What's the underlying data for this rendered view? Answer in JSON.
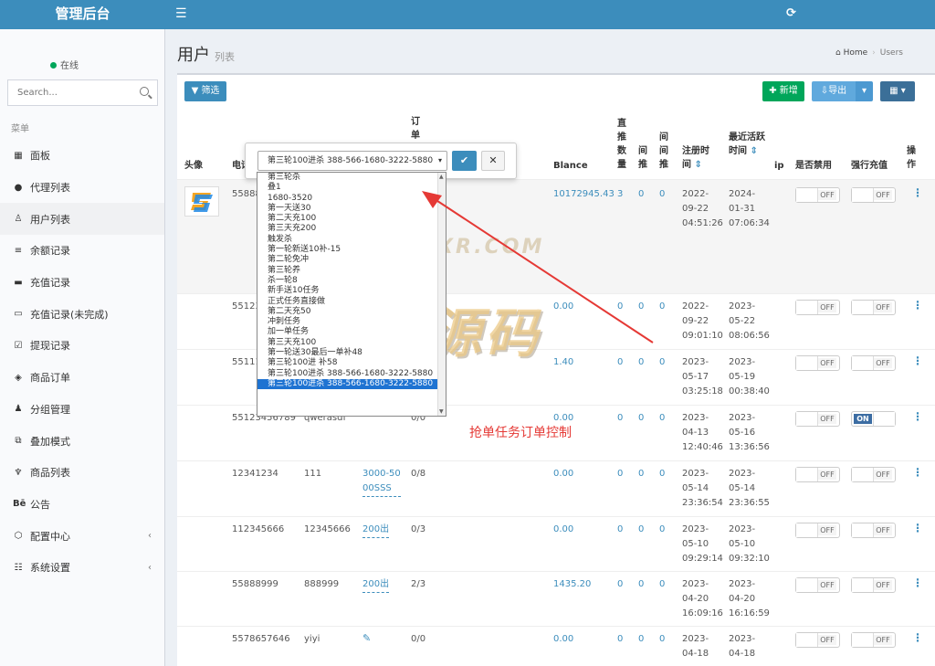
{
  "header": {
    "title": "管理后台"
  },
  "sidebar": {
    "status": "在线",
    "search_placeholder": "Search...",
    "menu_header": "菜单",
    "items": [
      {
        "label": "面板"
      },
      {
        "label": "代理列表"
      },
      {
        "label": "用户列表"
      },
      {
        "label": "余额记录"
      },
      {
        "label": "充值记录"
      },
      {
        "label": "充值记录(未完成)"
      },
      {
        "label": "提现记录"
      },
      {
        "label": "商品订单"
      },
      {
        "label": "分组管理"
      },
      {
        "label": "叠加模式"
      },
      {
        "label": "商品列表"
      },
      {
        "label": "公告"
      },
      {
        "label": "配置中心"
      },
      {
        "label": "系统设置"
      }
    ]
  },
  "page": {
    "title": "用户",
    "subtitle": "列表",
    "breadcrumb_home": "Home",
    "breadcrumb_current": "Users"
  },
  "toolbar": {
    "filter_label": "筛选",
    "add_label": "新增",
    "export_label": "导出"
  },
  "table": {
    "headers": {
      "avatar": "头像",
      "phone": "电话",
      "order": "订单",
      "balance": "Blance",
      "direct": "直推数量",
      "indirect": "间推",
      "indirect2": "间间推",
      "register": "注册时间",
      "last_active": "最近活跃时间",
      "ip": "ip",
      "disabled": "是否禁用",
      "force_recharge": "强行充值",
      "actions": "操作"
    },
    "rows": [
      {
        "phone": "55888",
        "account": "",
        "group": "",
        "orders": "",
        "balance": "10172945.43",
        "direct": "3",
        "indirect": "0",
        "indirect2": "0",
        "reg": [
          "2022-",
          "09-22",
          "04:51:26"
        ],
        "active": [
          "2024-",
          "01-31",
          "07:06:34"
        ],
        "disabled": "OFF",
        "force": "OFF"
      },
      {
        "phone": "55123",
        "account": "",
        "group": "",
        "orders": "",
        "balance": "0.00",
        "direct": "0",
        "indirect": "0",
        "indirect2": "0",
        "reg": [
          "2022-",
          "09-22",
          "09:01:10"
        ],
        "active": [
          "2023-",
          "05-22",
          "08:06:56"
        ],
        "disabled": "OFF",
        "force": "OFF"
      },
      {
        "phone": "55111",
        "account": "",
        "group": "",
        "orders": "",
        "balance": "1.40",
        "direct": "0",
        "indirect": "0",
        "indirect2": "0",
        "reg": [
          "2023-",
          "05-17",
          "03:25:18"
        ],
        "active": [
          "2023-",
          "05-19",
          "00:38:40"
        ],
        "disabled": "OFF",
        "force": "OFF"
      },
      {
        "phone": "55123456789",
        "account": "qwerasdf",
        "group": "",
        "orders": "0/0",
        "balance": "0.00",
        "direct": "0",
        "indirect": "0",
        "indirect2": "0",
        "reg": [
          "2023-",
          "04-13",
          "12:40:46"
        ],
        "active": [
          "2023-",
          "05-16",
          "13:36:56"
        ],
        "disabled": "OFF",
        "force": "ON"
      },
      {
        "phone": "12341234",
        "account": "111",
        "group": "3000-5000SSS",
        "orders": "0/8",
        "balance": "0.00",
        "direct": "0",
        "indirect": "0",
        "indirect2": "0",
        "reg": [
          "2023-",
          "05-14",
          "23:36:54"
        ],
        "active": [
          "2023-",
          "05-14",
          "23:36:55"
        ],
        "disabled": "OFF",
        "force": "OFF"
      },
      {
        "phone": "112345666",
        "account": "12345666",
        "group": "200出",
        "orders": "0/3",
        "balance": "0.00",
        "direct": "0",
        "indirect": "0",
        "indirect2": "0",
        "reg": [
          "2023-",
          "05-10",
          "09:29:14"
        ],
        "active": [
          "2023-",
          "05-10",
          "09:32:10"
        ],
        "disabled": "OFF",
        "force": "OFF"
      },
      {
        "phone": "55888999",
        "account": "888999",
        "group": "200出",
        "orders": "2/3",
        "balance": "1435.20",
        "direct": "0",
        "indirect": "0",
        "indirect2": "0",
        "reg": [
          "2023-",
          "04-20",
          "16:09:16"
        ],
        "active": [
          "2023-",
          "04-20",
          "16:16:59"
        ],
        "disabled": "OFF",
        "force": "OFF"
      },
      {
        "phone": "5578657646",
        "account": "yiyi",
        "group": "",
        "orders": "0/0",
        "balance": "0.00",
        "direct": "0",
        "indirect": "0",
        "indirect2": "0",
        "reg": [
          "2023-",
          "04-18",
          ""
        ],
        "active": [
          "2023-",
          "04-18",
          ""
        ],
        "disabled": "OFF",
        "force": "OFF"
      }
    ]
  },
  "popover": {
    "selected": "第三轮100进杀 388-566-1680-3222-5880",
    "options": [
      "第三轮杀",
      "叠1",
      "1680-3520",
      "第一天送30",
      "第二天充100",
      "第三天充200",
      "触发杀",
      "第一轮新送10补-15",
      "第二轮免冲",
      "第三轮养",
      "杀一轮8",
      "新手送10任务",
      "正式任务直接做",
      "第二天充50",
      "冲刺任务",
      "加一单任务",
      "第三天充100",
      "第一轮送30最后一单补48",
      "第三轮100进 补58",
      "第三轮100进杀 388-566-1680-3222-5880"
    ]
  },
  "annotation": "抢单任务订单控制",
  "watermark": {
    "small": "KYXR.COM",
    "big": "南亚源码"
  },
  "colors": {
    "header": "#3c8dbc",
    "green": "#00a65a",
    "red": "#e53935"
  }
}
